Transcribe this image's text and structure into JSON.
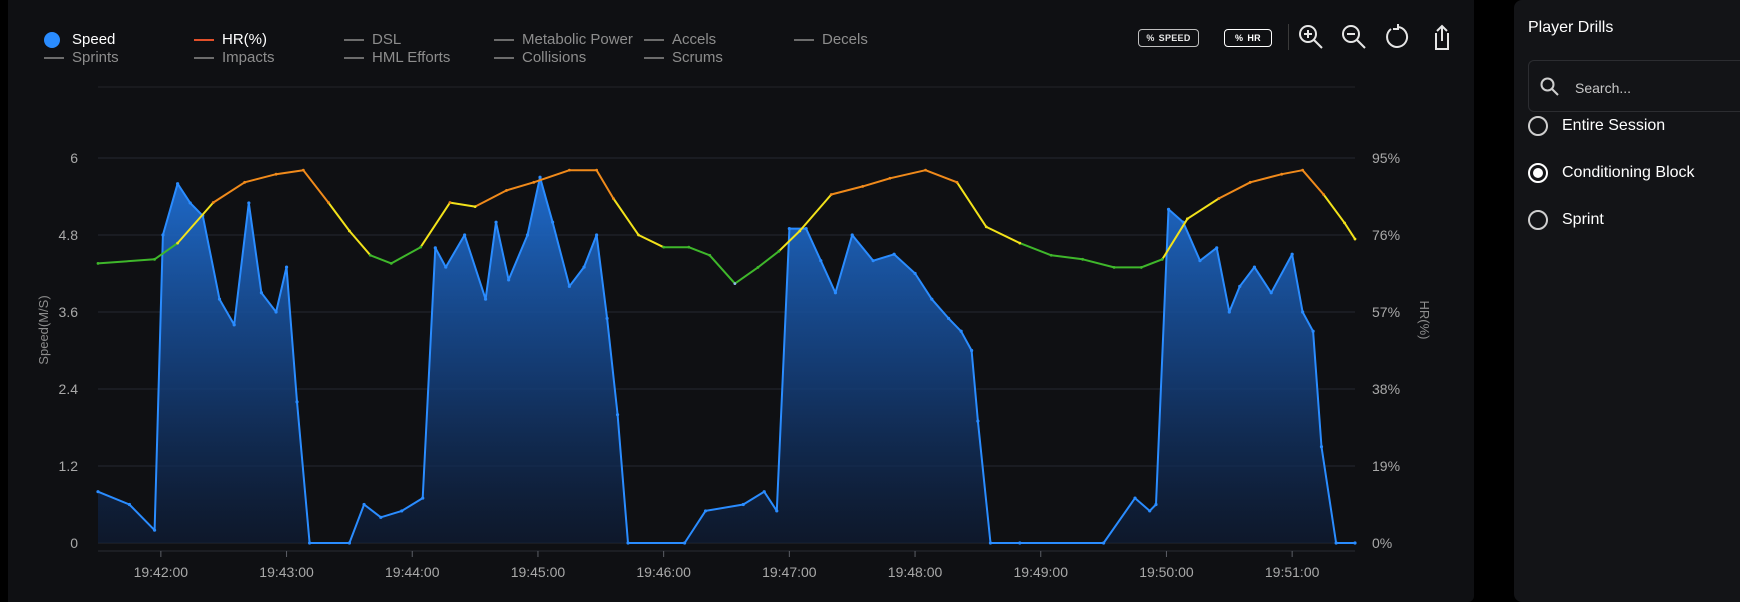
{
  "legend": [
    {
      "label": "Speed",
      "active": true,
      "type": "dot"
    },
    {
      "label": "HR(%)",
      "active": true,
      "type": "line"
    },
    {
      "label": "DSL",
      "active": false,
      "type": "line"
    },
    {
      "label": "Metabolic Power",
      "active": false,
      "type": "line"
    },
    {
      "label": "Accels",
      "active": false,
      "type": "line"
    },
    {
      "label": "Decels",
      "active": false,
      "type": "line"
    },
    {
      "label": "Sprints",
      "active": false,
      "type": "line"
    },
    {
      "label": "Impacts",
      "active": false,
      "type": "line"
    },
    {
      "label": "HML Efforts",
      "active": false,
      "type": "line"
    },
    {
      "label": "Collisions",
      "active": false,
      "type": "line"
    },
    {
      "label": "Scrums",
      "active": false,
      "type": "line"
    }
  ],
  "toolbar": {
    "speed_pill": "SPEED",
    "hr_pill": "HR",
    "tools": [
      "zoom-in-icon",
      "zoom-out-icon",
      "reset-icon",
      "share-icon"
    ]
  },
  "colors": {
    "speed": "#2a8cff",
    "hr_low": "#3fb72b",
    "hr_mid": "#f2e21a",
    "hr_high": "#f08a1b",
    "hr_min": "#8fb9e8",
    "hr_legend": "#e2502a"
  },
  "chart_data": {
    "type": "area",
    "xlabel": "",
    "ylabel": "Speed(M/S)",
    "y2label": "HR(%)",
    "ylim": [
      0,
      6
    ],
    "yticks": [
      "0",
      "1.2",
      "2.4",
      "3.6",
      "4.8",
      "6"
    ],
    "y2ticks": [
      "0%",
      "19%",
      "38%",
      "57%",
      "76%",
      "95%"
    ],
    "xlim": [
      "19:41:30",
      "19:51:30"
    ],
    "xticks": [
      "19:42:00",
      "19:43:00",
      "19:44:00",
      "19:45:00",
      "19:46:00",
      "19:47:00",
      "19:48:00",
      "19:49:00",
      "19:50:00",
      "19:51:00"
    ],
    "grid": true,
    "series": [
      {
        "name": "Speed",
        "x": [
          "19:41:30",
          "19:41:45",
          "19:41:57",
          "19:42:01",
          "19:42:08",
          "19:42:14",
          "19:42:20",
          "19:42:28",
          "19:42:35",
          "19:42:42",
          "19:42:48",
          "19:42:55",
          "19:43:00",
          "19:43:05",
          "19:43:11",
          "19:43:30",
          "19:43:37",
          "19:43:45",
          "19:43:55",
          "19:44:05",
          "19:44:11",
          "19:44:16",
          "19:44:25",
          "19:44:35",
          "19:44:40",
          "19:44:46",
          "19:44:55",
          "19:45:01",
          "19:45:07",
          "19:45:15",
          "19:45:22",
          "19:45:28",
          "19:45:33",
          "19:45:38",
          "19:45:43",
          "19:46:10",
          "19:46:20",
          "19:46:38",
          "19:46:48",
          "19:46:54",
          "19:47:00",
          "19:47:08",
          "19:47:15",
          "19:47:22",
          "19:47:30",
          "19:47:40",
          "19:47:50",
          "19:48:00",
          "19:48:08",
          "19:48:16",
          "19:48:22",
          "19:48:27",
          "19:48:30",
          "19:48:36",
          "19:48:50",
          "19:49:30",
          "19:49:45",
          "19:49:52",
          "19:49:55",
          "19:50:01",
          "19:50:08",
          "19:50:16",
          "19:50:24",
          "19:50:30",
          "19:50:35",
          "19:50:42",
          "19:50:50",
          "19:51:00",
          "19:51:05",
          "19:51:10",
          "19:51:14",
          "19:51:21",
          "19:51:30"
        ],
        "values": [
          0.8,
          0.6,
          0.2,
          4.8,
          5.6,
          5.3,
          5.1,
          3.8,
          3.4,
          5.3,
          3.9,
          3.6,
          4.3,
          2.2,
          0,
          0,
          0.6,
          0.4,
          0.5,
          0.7,
          4.6,
          4.3,
          4.8,
          3.8,
          5.0,
          4.1,
          4.8,
          5.7,
          5.0,
          4.0,
          4.3,
          4.8,
          3.5,
          2.0,
          0,
          0,
          0.5,
          0.6,
          0.8,
          0.5,
          4.9,
          4.9,
          4.4,
          3.9,
          4.8,
          4.4,
          4.5,
          4.2,
          3.8,
          3.5,
          3.3,
          3.0,
          1.9,
          0,
          0,
          0,
          0.7,
          0.5,
          0.6,
          5.2,
          5.0,
          4.4,
          4.6,
          3.6,
          4.0,
          4.3,
          3.9,
          4.5,
          3.6,
          3.3,
          1.5,
          0,
          0
        ]
      },
      {
        "name": "HR(%)",
        "x": [
          "19:41:30",
          "19:41:57",
          "19:42:08",
          "19:42:25",
          "19:42:40",
          "19:42:55",
          "19:43:08",
          "19:43:20",
          "19:43:30",
          "19:43:40",
          "19:43:50",
          "19:44:04",
          "19:44:18",
          "19:44:30",
          "19:44:45",
          "19:44:58",
          "19:45:15",
          "19:45:28",
          "19:45:36",
          "19:45:48",
          "19:46:00",
          "19:46:12",
          "19:46:22",
          "19:46:34",
          "19:46:45",
          "19:46:55",
          "19:47:05",
          "19:47:20",
          "19:47:35",
          "19:47:48",
          "19:48:05",
          "19:48:20",
          "19:48:34",
          "19:48:50",
          "19:49:05",
          "19:49:20",
          "19:49:35",
          "19:49:48",
          "19:49:58",
          "19:50:10",
          "19:50:25",
          "19:50:40",
          "19:50:55",
          "19:51:05",
          "19:51:15",
          "19:51:25",
          "19:51:30"
        ],
        "values": [
          69,
          70,
          74,
          84,
          89,
          91,
          92,
          84,
          77,
          71,
          69,
          73,
          84,
          83,
          87,
          89,
          92,
          92,
          85,
          76,
          73,
          73,
          71,
          64,
          68,
          72,
          77,
          86,
          88,
          90,
          92,
          89,
          78,
          74,
          71,
          70,
          68,
          68,
          70,
          80,
          85,
          89,
          91,
          92,
          86,
          79,
          75
        ]
      }
    ]
  },
  "sidebar": {
    "title": "Player Drills",
    "search_placeholder": "Search...",
    "drills": [
      {
        "label": "Entire Session",
        "selected": false
      },
      {
        "label": "Conditioning Block",
        "selected": true
      },
      {
        "label": "Sprint",
        "selected": false
      }
    ]
  }
}
